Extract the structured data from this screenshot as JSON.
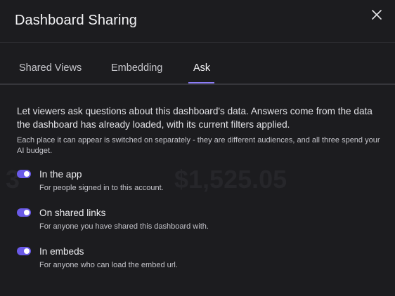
{
  "modal": {
    "title": "Dashboard Sharing",
    "close_icon": "close-icon"
  },
  "tabs": [
    {
      "label": "Shared Views",
      "active": false
    },
    {
      "label": "Embedding",
      "active": false
    },
    {
      "label": "Ask",
      "active": true
    }
  ],
  "ask": {
    "description": "Let viewers ask questions about this dashboard's data. Answers come from the data the dashboard has already loaded, with its current filters applied.",
    "note": "Each place it can appear is switched on separately - they are different audiences, and all three spend your AI budget.",
    "options": [
      {
        "label": "In the app",
        "description": "For people signed in to this account.",
        "enabled": true
      },
      {
        "label": "On shared links",
        "description": "For anyone you have shared this dashboard with.",
        "enabled": true
      },
      {
        "label": "In embeds",
        "description": "For anyone who can load the embed url.",
        "enabled": true
      }
    ]
  },
  "background_ghost": {
    "number_left": "3",
    "number_right": "$1,525.05"
  },
  "colors": {
    "background": "#1c1c1f",
    "accent": "#8b7cf6",
    "toggle_on": "#6a5ae8",
    "text_primary": "#ececef",
    "text_secondary": "#c4c4ca"
  }
}
